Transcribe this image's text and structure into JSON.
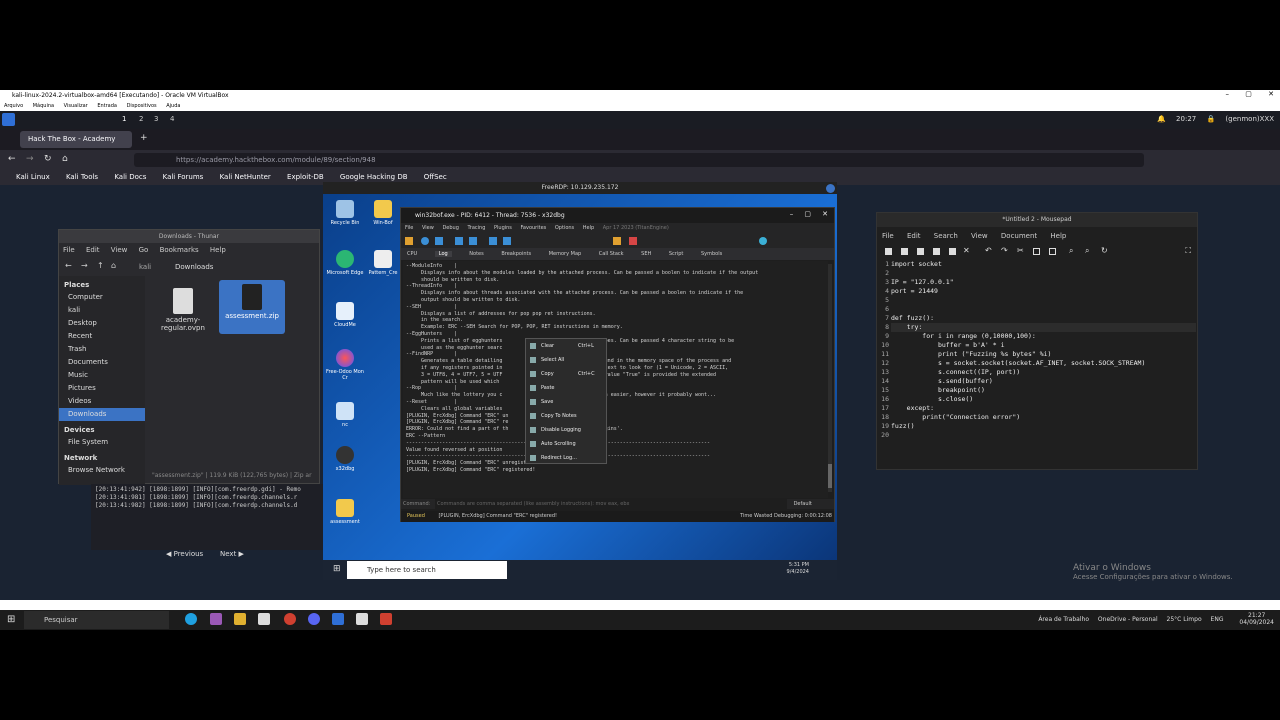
{
  "host": {
    "vbox_title": "kali-linux-2024.2-virtualbox-amd64 [Executando] - Oracle VM VirtualBox",
    "vbox_menu": [
      "Arquivo",
      "Máquina",
      "Visualizar",
      "Entrada",
      "Dispositivos",
      "Ajuda"
    ],
    "taskbar_search": "Pesquisar",
    "tray": {
      "desktop": "Área de Trabalho",
      "onedrive": "OneDrive - Personal",
      "weather": "25°C  Limpo",
      "lang": "ENG",
      "time": "21:27",
      "date": "04/09/2024"
    },
    "activate_title": "Ativar o Windows",
    "activate_sub": "Acesse Configurações para ativar o Windows."
  },
  "kali": {
    "workspaces": [
      "1",
      "2",
      "3",
      "4"
    ],
    "clock": "20:27",
    "user": "(genmon)XXX"
  },
  "firefox": {
    "tab_title": "Hack The Box - Academy",
    "url": "https://academy.hackthebox.com/module/89/section/948",
    "bookmarks": [
      "Kali Linux",
      "Kali Tools",
      "Kali Docs",
      "Kali Forums",
      "Kali NetHunter",
      "Exploit-DB",
      "Google Hacking DB",
      "OffSec"
    ],
    "prev_label": "Previous",
    "next_label": "Next"
  },
  "thunar": {
    "title": "Downloads - Thunar",
    "menu": [
      "File",
      "Edit",
      "View",
      "Go",
      "Bookmarks",
      "Help"
    ],
    "path": [
      "kali",
      "Downloads"
    ],
    "places_header": "Places",
    "places": [
      "Computer",
      "kali",
      "Desktop",
      "Recent",
      "Trash",
      "Documents",
      "Music",
      "Pictures",
      "Videos",
      "Downloads"
    ],
    "devices_header": "Devices",
    "devices": [
      "File System"
    ],
    "network_header": "Network",
    "network": [
      "Browse Network"
    ],
    "files": [
      "academy-regular.ovpn",
      "assessment.zip"
    ],
    "status": "\"assessment.zip\" | 119.9 KiB (122,765 bytes) | Zip ar"
  },
  "terminal": {
    "lines": [
      "[20:13:41:942] [1898:1899] [INFO][com.freerdp.gdi] - Remo",
      "[20:13:41:981] [1898:1899] [INFO][com.freerdp.channels.r",
      "[20:13:41:982] [1898:1899] [INFO][com.freerdp.channels.d"
    ]
  },
  "rdp": {
    "title": "FreeRDP: 10.129.235.172",
    "desktop_icons": [
      "Recycle Bin",
      "Win-Bof",
      "Microsoft Edge",
      "Pattern_Cre",
      "CloudMe",
      "Free-Odoo Mon Cr",
      "nc",
      "x32dbg",
      "assessment"
    ],
    "search_placeholder": "Type here to search",
    "time": "5:31 PM",
    "date": "9/4/2024"
  },
  "x32dbg": {
    "title": "win32bof.exe - PID: 6412 - Thread: 7536 - x32dbg",
    "menu": [
      "File",
      "View",
      "Debug",
      "Tracing",
      "Plugins",
      "Favourites",
      "Options",
      "Help",
      "Apr 17 2023 (TitanEngine)"
    ],
    "tabs": [
      "CPU",
      "Log",
      "Notes",
      "Breakpoints",
      "Memory Map",
      "Call Stack",
      "SEH",
      "Script",
      "Symbols"
    ],
    "log_lines": [
      "--ModuleInfo    |",
      "     Displays info about the modules loaded by the attached process. Can be passed a boolen to indicate if the output",
      "     should be written to disk.",
      "--ThreadInfo    |",
      "     Displays info about threads associated with the attached process. Can be passed a boolen to indicate if the",
      "     output should be written to disk.",
      "--SEH           |",
      "     Displays a list of addresses for pop pop ret instructions.",
      "     in the search.",
      "     Example: ERC --SEH Search for POP, POP, RET instructions in memory.",
      "--EggHunters    |",
      "     Prints a list of egghunters                  rious machine types. Can be passed 4 character string to be",
      "     used as the egghunter searc                  ).",
      "--FindNRP       |",
      "     Generates a table detailing                  tern has been found in the memory space of the process and",
      "     if any registers pointed in                  integer for the text to look for (1 = Unicode, 2 = ASCII,",
      "     3 = UTF8, 4 = UTF7, 5 = UTF                  tionally if the value \"True\" is provided the extended",
      "     pattern will be used which                   rs.",
      "--Rop           |",
      "     Much like the lottery you c                  life may get much easier, however it probably wont...",
      "--Reset         |",
      "     Clears all global variables                  tions.",
      "[PLUGIN, ErcXdbg] Command \"ERC\" un",
      "[PLUGIN, ErcXdbg] Command \"ERC\" re",
      "ERROR: Could not find a part of th                  of4dbg\\x64\\plugins'.",
      "",
      "ERC --Pattern",
      "-----------------------------------------------------------------------------------------------------",
      "Value found reversed at position",
      "-----------------------------------------------------------------------------------------------------",
      "[PLUGIN, ErcXdbg] Command \"ERC\" unregistered!",
      "[PLUGIN, ErcXdbg] Command \"ERC\" registered!"
    ],
    "command_label": "Command:",
    "command_placeholder": "Commands are comma separated (like assembly instructions): mov eax, ebx",
    "command_mode": "Default",
    "status_state": "Paused",
    "status_msg": "[PLUGIN, ErcXdbg] Command \"ERC\" registered!",
    "status_time": "Time Wasted Debugging: 0:00:12:08",
    "context_menu": [
      {
        "label": "Clear",
        "shortcut": "Ctrl+L"
      },
      {
        "label": "Select All",
        "shortcut": ""
      },
      {
        "label": "Copy",
        "shortcut": "Ctrl+C"
      },
      {
        "label": "Paste",
        "shortcut": ""
      },
      {
        "label": "Save",
        "shortcut": ""
      },
      {
        "label": "Copy To Notes",
        "shortcut": ""
      },
      {
        "label": "Disable Logging",
        "shortcut": ""
      },
      {
        "label": "Auto Scrolling",
        "shortcut": ""
      },
      {
        "label": "Redirect Log...",
        "shortcut": ""
      }
    ]
  },
  "mousepad": {
    "title": "*Untitled 2 - Mousepad",
    "menu": [
      "File",
      "Edit",
      "Search",
      "View",
      "Document",
      "Help"
    ],
    "line_numbers": [
      "1",
      "2",
      "3",
      "4",
      "5",
      "6",
      "7",
      "8",
      "9",
      "10",
      "11",
      "12",
      "13",
      "14",
      "15",
      "16",
      "17",
      "18",
      "19",
      "20"
    ],
    "code": "import socket\n\nIP = \"127.0.0.1\"\nport = 21449\n\n\ndef fuzz():\n    try:\n        for i in range (0,10000,100):\n            buffer = b'A' * i\n            print (\"Fuzzing %s bytes\" %i)\n            s = socket.socket(socket.AF_INET, socket.SOCK_STREAM)\n            s.connect((IP, port))\n            s.send(buffer)\n            breakpoint()\n            s.close()\n    except:\n        print(\"Connection error\")\nfuzz()\n"
  }
}
